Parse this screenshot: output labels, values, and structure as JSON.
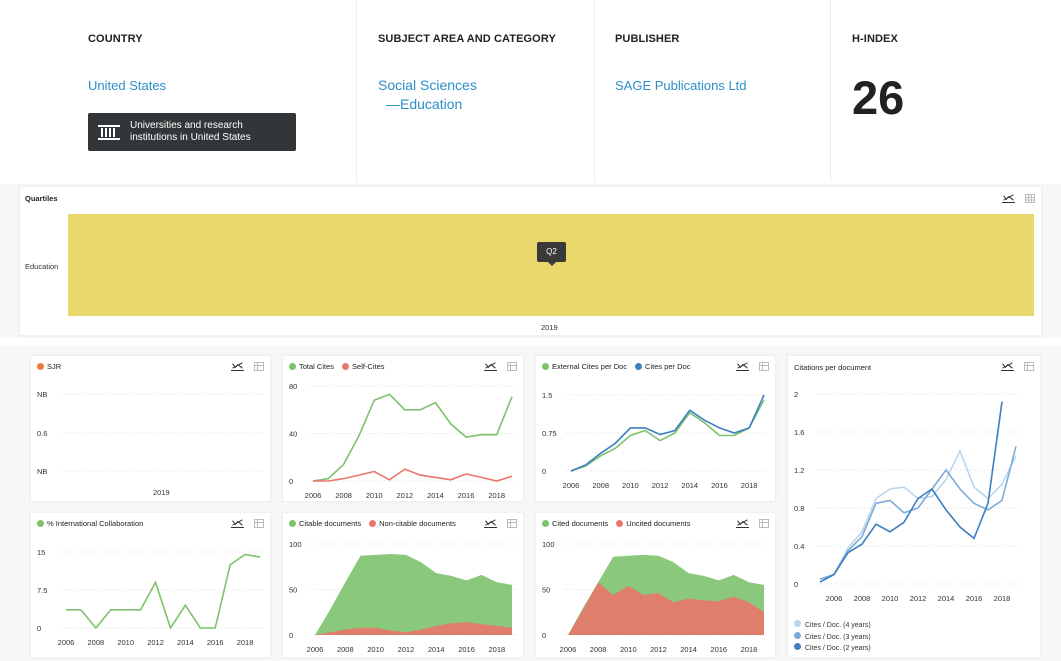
{
  "info": {
    "country": {
      "heading": "COUNTRY",
      "value": "United States",
      "inst_button": "Universities and research institutions in United States"
    },
    "subject": {
      "heading": "SUBJECT AREA AND CATEGORY",
      "area": "Social Sciences",
      "category": "—Education"
    },
    "publisher": {
      "heading": "PUBLISHER",
      "value": "SAGE Publications Ltd"
    },
    "hindex": {
      "heading": "H-INDEX",
      "value": "26"
    }
  },
  "icons": {
    "institution": "building-columns-icon",
    "line_chart": "line-chart-icon",
    "table": "table-icon"
  },
  "colors": {
    "link": "#2a8fc7",
    "green": "#7dc26d",
    "red": "#e8766c",
    "blue": "#3d7fc1",
    "lightblue": "#b9d6ee",
    "midblue": "#7dabd9",
    "quartile": "#e8d76a",
    "orange": "#f07a3c"
  },
  "chart_data": [
    {
      "id": "quartiles",
      "type": "heatmap",
      "title": "Quartiles",
      "rows": [
        "Education"
      ],
      "categories": [
        "2019"
      ],
      "values": [
        [
          "Q2"
        ]
      ],
      "tooltip": "Q2"
    },
    {
      "id": "sjr",
      "type": "line",
      "legend": [
        {
          "name": "SJR",
          "color": "#f07a3c"
        }
      ],
      "y_ticks": [
        "NB",
        "0.6",
        "NB"
      ],
      "categories": [
        "2019"
      ],
      "series": [
        {
          "name": "SJR",
          "values": []
        }
      ]
    },
    {
      "id": "cites",
      "type": "line",
      "x": [
        2006,
        2007,
        2008,
        2009,
        2010,
        2011,
        2012,
        2013,
        2014,
        2015,
        2016,
        2017,
        2018,
        2019
      ],
      "x_ticks": [
        2006,
        2008,
        2010,
        2012,
        2014,
        2016,
        2018
      ],
      "y_ticks": [
        0,
        40,
        80
      ],
      "ylim": [
        0,
        80
      ],
      "series": [
        {
          "name": "Total Cites",
          "color": "#7dc26d",
          "values": [
            0,
            2,
            14,
            38,
            68,
            73,
            60,
            60,
            66,
            48,
            37,
            39,
            39,
            71
          ]
        },
        {
          "name": "Self-Cites",
          "color": "#e8766c",
          "values": [
            0,
            0,
            2,
            5,
            8,
            1,
            10,
            5,
            3,
            1,
            6,
            3,
            0,
            4
          ]
        }
      ]
    },
    {
      "id": "cites_per_doc",
      "type": "line",
      "x": [
        2006,
        2007,
        2008,
        2009,
        2010,
        2011,
        2012,
        2013,
        2014,
        2015,
        2016,
        2017,
        2018,
        2019
      ],
      "x_ticks": [
        2006,
        2008,
        2010,
        2012,
        2014,
        2016,
        2018
      ],
      "y_ticks": [
        0,
        0.75,
        1.5
      ],
      "ylim": [
        0,
        1.5
      ],
      "series": [
        {
          "name": "External Cites per Doc",
          "color": "#7dc26d",
          "values": [
            0,
            0.1,
            0.3,
            0.45,
            0.7,
            0.8,
            0.6,
            0.75,
            1.15,
            0.95,
            0.7,
            0.7,
            0.85,
            1.4
          ]
        },
        {
          "name": "Cites per Doc",
          "color": "#3d7fc1",
          "values": [
            0,
            0.12,
            0.35,
            0.55,
            0.85,
            0.85,
            0.72,
            0.8,
            1.2,
            1.0,
            0.85,
            0.75,
            0.85,
            1.5
          ]
        }
      ]
    },
    {
      "id": "citations_per_document",
      "type": "line",
      "title": "Citations per document",
      "x": [
        2005,
        2006,
        2007,
        2008,
        2009,
        2010,
        2011,
        2012,
        2013,
        2014,
        2015,
        2016,
        2017,
        2018,
        2019
      ],
      "x_ticks": [
        2006,
        2008,
        2010,
        2012,
        2014,
        2016,
        2018
      ],
      "y_ticks": [
        0,
        0.4,
        0.8,
        1.2,
        1.6,
        2
      ],
      "ylim": [
        0,
        2
      ],
      "series": [
        {
          "name": "Cites / Doc. (4 years)",
          "color": "#b9d6ee",
          "values": [
            0.05,
            0.1,
            0.38,
            0.55,
            0.9,
            1.0,
            1.02,
            0.9,
            0.92,
            1.1,
            1.4,
            1.02,
            0.9,
            1.05,
            1.35
          ]
        },
        {
          "name": "Cites / Doc. (3 years)",
          "color": "#7dabd9",
          "values": [
            0.05,
            0.1,
            0.35,
            0.5,
            0.85,
            0.88,
            0.75,
            0.8,
            1.0,
            1.2,
            1.0,
            0.85,
            0.78,
            0.88,
            1.45
          ]
        },
        {
          "name": "Cites / Doc. (2 years)",
          "color": "#3d7fc1",
          "values": [
            0.02,
            0.1,
            0.33,
            0.42,
            0.63,
            0.55,
            0.65,
            0.9,
            1.0,
            0.78,
            0.6,
            0.48,
            0.85,
            1.92
          ]
        }
      ]
    },
    {
      "id": "intl_collab",
      "type": "line",
      "x": [
        2006,
        2007,
        2008,
        2009,
        2010,
        2011,
        2012,
        2013,
        2014,
        2015,
        2016,
        2017,
        2018,
        2019
      ],
      "x_ticks": [
        2006,
        2008,
        2010,
        2012,
        2014,
        2016,
        2018
      ],
      "y_ticks": [
        0,
        7.5,
        15
      ],
      "ylim": [
        0,
        15
      ],
      "series": [
        {
          "name": "% International Collaboration",
          "color": "#7dc26d",
          "values": [
            3.6,
            3.6,
            0,
            3.6,
            3.6,
            3.6,
            9,
            0,
            4.5,
            0,
            0,
            12.5,
            14.5,
            14
          ]
        }
      ]
    },
    {
      "id": "citable_docs",
      "type": "area",
      "x": [
        2006,
        2007,
        2008,
        2009,
        2010,
        2011,
        2012,
        2013,
        2014,
        2015,
        2016,
        2017,
        2018,
        2019
      ],
      "x_ticks": [
        2006,
        2008,
        2010,
        2012,
        2014,
        2016,
        2018
      ],
      "y_ticks": [
        0,
        50,
        100
      ],
      "ylim": [
        0,
        100
      ],
      "series": [
        {
          "name": "Citable documents",
          "color": "#7dc26d",
          "values": [
            0,
            28,
            58,
            87,
            88,
            89,
            88,
            80,
            68,
            65,
            60,
            66,
            58,
            55
          ]
        },
        {
          "name": "Non-citable documents",
          "color": "#e8766c",
          "values": [
            0,
            3,
            6,
            8,
            8,
            5,
            3,
            6,
            10,
            13,
            14,
            12,
            10,
            8
          ]
        }
      ]
    },
    {
      "id": "cited_docs",
      "type": "area",
      "x": [
        2006,
        2007,
        2008,
        2009,
        2010,
        2011,
        2012,
        2013,
        2014,
        2015,
        2016,
        2017,
        2018,
        2019
      ],
      "x_ticks": [
        2006,
        2008,
        2010,
        2012,
        2014,
        2016,
        2018
      ],
      "y_ticks": [
        0,
        50,
        100
      ],
      "ylim": [
        0,
        100
      ],
      "series": [
        {
          "name": "Cited documents",
          "color": "#7dc26d",
          "values": [
            0,
            30,
            58,
            86,
            87,
            88,
            87,
            80,
            68,
            65,
            60,
            66,
            58,
            55
          ]
        },
        {
          "name": "Uncited documents",
          "color": "#e8766c",
          "values": [
            0,
            28,
            58,
            44,
            54,
            44,
            46,
            36,
            40,
            38,
            37,
            42,
            36,
            25
          ]
        }
      ]
    }
  ]
}
